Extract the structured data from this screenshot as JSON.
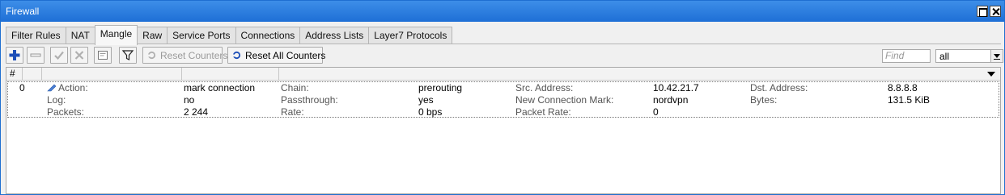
{
  "window": {
    "title": "Firewall"
  },
  "tabs": [
    {
      "label": "Filter Rules",
      "active": false
    },
    {
      "label": "NAT",
      "active": false
    },
    {
      "label": "Mangle",
      "active": true
    },
    {
      "label": "Raw",
      "active": false
    },
    {
      "label": "Service Ports",
      "active": false
    },
    {
      "label": "Connections",
      "active": false
    },
    {
      "label": "Address Lists",
      "active": false
    },
    {
      "label": "Layer7 Protocols",
      "active": false
    }
  ],
  "toolbar": {
    "add_icon": "plus-icon",
    "remove_icon": "minus-icon",
    "enable_icon": "check-icon",
    "disable_icon": "x-icon",
    "comment_icon": "note-icon",
    "filter_icon": "funnel-icon",
    "reset_counters_label": "Reset Counters",
    "reset_all_counters_label": "Reset All Counters",
    "find_placeholder": "Find",
    "filter_value": "all",
    "accent_color": "#1d4fb8"
  },
  "table": {
    "header_number": "#",
    "rows": [
      {
        "number": "0",
        "fields": [
          {
            "label": "Action:",
            "value": "mark connection"
          },
          {
            "label": "Chain:",
            "value": "prerouting"
          },
          {
            "label": "Src. Address:",
            "value": "10.42.21.7"
          },
          {
            "label": "Dst. Address:",
            "value": "8.8.8.8"
          },
          {
            "label": "Log:",
            "value": "no"
          },
          {
            "label": "Passthrough:",
            "value": "yes"
          },
          {
            "label": "New Connection Mark:",
            "value": "nordvpn"
          },
          {
            "label": "Bytes:",
            "value": "131.5 KiB"
          },
          {
            "label": "Packets:",
            "value": "2 244"
          },
          {
            "label": "Rate:",
            "value": "0 bps"
          },
          {
            "label": "Packet Rate:",
            "value": "0"
          }
        ]
      }
    ]
  }
}
